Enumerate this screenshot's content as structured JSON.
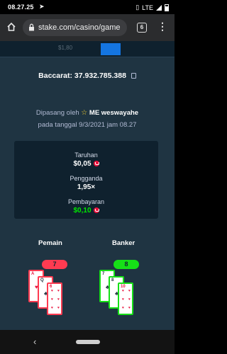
{
  "status_bar": {
    "time": "08.27.25",
    "network": "LTE"
  },
  "browser": {
    "url": "stake.com/casino/game",
    "tab_count": "6"
  },
  "background_page": {
    "balance": "$1,80"
  },
  "modal": {
    "title": "Baccarat: 37.932.785.388",
    "placed_by_prefix": "Dipasang oleh",
    "username": "ME weswayahe",
    "date_text": "pada tanggal 9/3/2021 jam 08.27",
    "bet_label": "Taruhan",
    "bet_value": "$0,05",
    "multiplier_label": "Pengganda",
    "multiplier_value": "1,95×",
    "payout_label": "Pembayaran",
    "payout_value": "$0,10",
    "player_label": "Pemain",
    "banker_label": "Banker",
    "player_score": "7",
    "banker_score": "8",
    "player_cards": [
      {
        "rank": "A",
        "suit": "heart",
        "color": "red"
      },
      {
        "rank": "Q",
        "suit": "club",
        "color": "black"
      },
      {
        "rank": "6",
        "suit": "heart",
        "color": "red"
      }
    ],
    "banker_cards": [
      {
        "rank": "7",
        "suit": "club",
        "color": "black"
      },
      {
        "rank": "8",
        "suit": "club",
        "color": "black"
      },
      {
        "rank": "10",
        "suit": "heart",
        "color": "red"
      }
    ]
  },
  "colors": {
    "modal_bg": "#1f3442",
    "stats_bg": "#0f212e",
    "loss": "#ff3b51",
    "win": "#16e017",
    "currency_gem": "#e9113c"
  }
}
